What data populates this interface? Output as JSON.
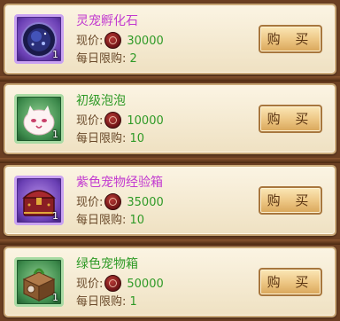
{
  "price_label": "现价:",
  "limit_label": "每日限购:",
  "buy_label": "购 买",
  "items": [
    {
      "name": "灵宠孵化石",
      "price": "30000",
      "limit": "2",
      "qty": "1",
      "rarity": "purple",
      "icon": "hatching-stone-icon"
    },
    {
      "name": "初级泡泡",
      "price": "10000",
      "limit": "10",
      "qty": "1",
      "rarity": "green",
      "icon": "bubble-creature-icon"
    },
    {
      "name": "紫色宠物经验箱",
      "price": "35000",
      "limit": "10",
      "qty": "1",
      "rarity": "purple",
      "icon": "purple-exp-chest-icon"
    },
    {
      "name": "绿色宠物箱",
      "price": "50000",
      "limit": "1",
      "qty": "1",
      "rarity": "green",
      "icon": "green-pet-box-icon"
    }
  ],
  "colors": {
    "purple_name": "#c23ad0",
    "green_name": "#2f9a27",
    "value": "#2f9a27"
  }
}
